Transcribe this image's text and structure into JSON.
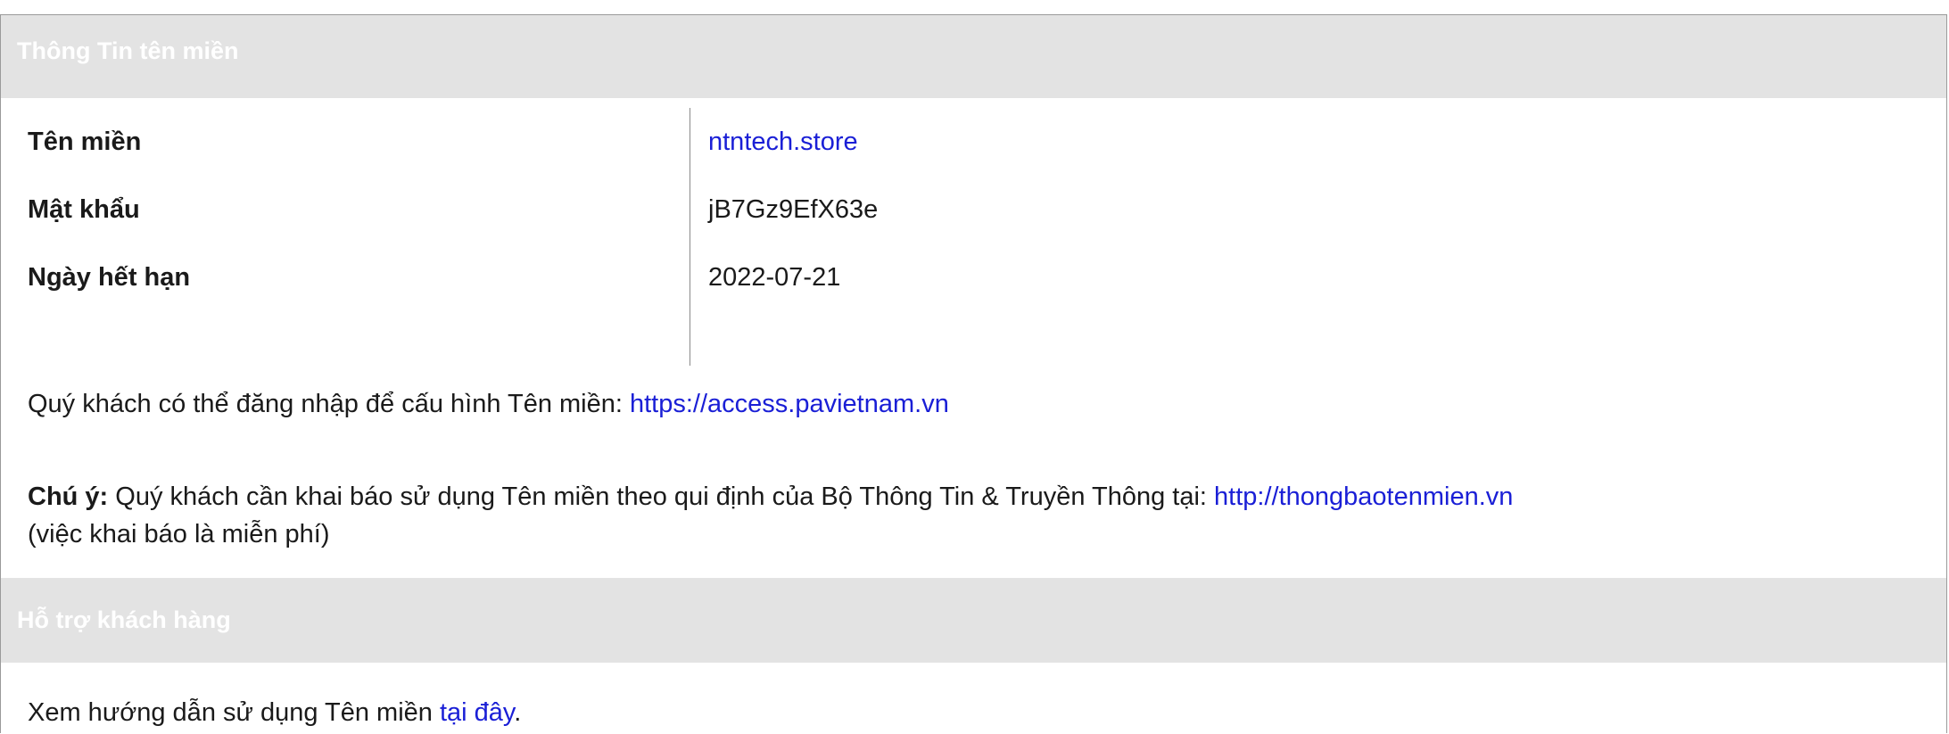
{
  "domain_section": {
    "header": "Thông Tin tên miền",
    "rows": [
      {
        "label": "Tên miền",
        "value": "ntntech.store",
        "is_link": true
      },
      {
        "label": "Mật khẩu",
        "value": "jB7Gz9EfX63e",
        "is_link": false
      },
      {
        "label": "Ngày hết hạn",
        "value": "2022-07-21",
        "is_link": false
      }
    ],
    "login_text": "Quý khách có thể đăng nhập để cấu hình Tên miền: ",
    "login_link": "https://access.pavietnam.vn",
    "note_label": "Chú ý:",
    "note_text": " Quý khách cần khai báo sử dụng Tên miền theo qui định của Bộ Thông Tin & Truyền Thông tại: ",
    "note_link": "http://thongbaotenmien.vn",
    "note_suffix": "(việc khai báo là miễn phí)"
  },
  "support_section": {
    "header": "Hỗ trợ khách hàng",
    "guide_text": "Xem hướng dẫn sử dụng Tên miền ",
    "guide_link": "tại đây",
    "guide_end": "."
  },
  "colors": {
    "header_bg": "#e3e3e3",
    "header_text": "#ffffff",
    "link": "#1a1fd6",
    "text": "#1a1a1a",
    "border": "#9a9a9a"
  }
}
